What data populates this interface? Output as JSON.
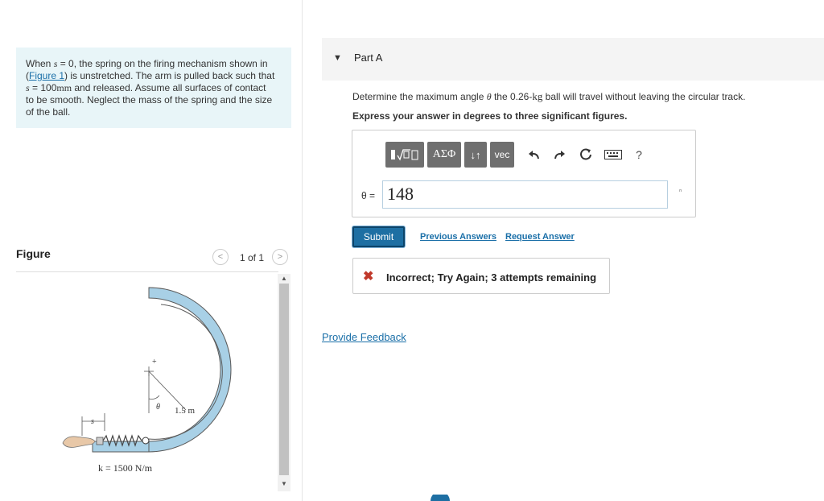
{
  "problem": {
    "t1": "When ",
    "s_sym1": "s",
    "t2": " = 0, the spring on the firing mechanism shown in",
    "t3": "(",
    "figure_link": "Figure 1",
    "t4": ") is unstretched. The arm is pulled back such that",
    "s_sym2": "s",
    "t5": " = 100",
    "unit_mm": "mm",
    "t6": " and released. Assume all surfaces of contact",
    "t7": "to be smooth. Neglect the mass of the spring and the size",
    "t8": "of the ball."
  },
  "figure": {
    "label": "Figure",
    "pager": "1 of 1",
    "prev_glyph": "<",
    "next_glyph": ">",
    "labels": {
      "radius": "1.5 m",
      "theta": "θ",
      "spring_k": "k = 1500 N/m",
      "s": "s",
      "plus": "+"
    },
    "colors": {
      "track": "#a8d0e6",
      "track_edge": "#5a5a5a",
      "platform": "#a8d0e6"
    }
  },
  "part": {
    "title": "Part A",
    "q_pre": "Determine the maximum angle ",
    "q_theta": "θ",
    "q_mid": " the 0.26-",
    "q_kg": "kg",
    "q_post": " ball will travel without leaving the circular track.",
    "instructions": "Express your answer in degrees to three significant figures."
  },
  "toolbar": {
    "template_icon": "template-sqrt-icon",
    "greek": "ΑΣΦ",
    "arrows": "↓↑",
    "vec": "vec",
    "undo_icon": "undo-icon",
    "redo_icon": "redo-icon",
    "reset_icon": "reset-icon",
    "keyboard_icon": "keyboard-icon",
    "help": "?"
  },
  "answer": {
    "label": "θ =",
    "value": "148",
    "caret": "ⁿ"
  },
  "actions": {
    "submit": "Submit",
    "previous_answers": "Previous Answers",
    "request_answer": "Request Answer"
  },
  "feedback": {
    "icon": "✖",
    "message": "Incorrect; Try Again; 3 attempts remaining"
  },
  "provide_feedback": "Provide Feedback",
  "colors": {
    "accent": "#1e6fa3",
    "link": "#1a6fa8",
    "error": "#c0392b",
    "problem_bg": "#e8f5f8",
    "toolbar_btn": "#6f6f6f"
  }
}
